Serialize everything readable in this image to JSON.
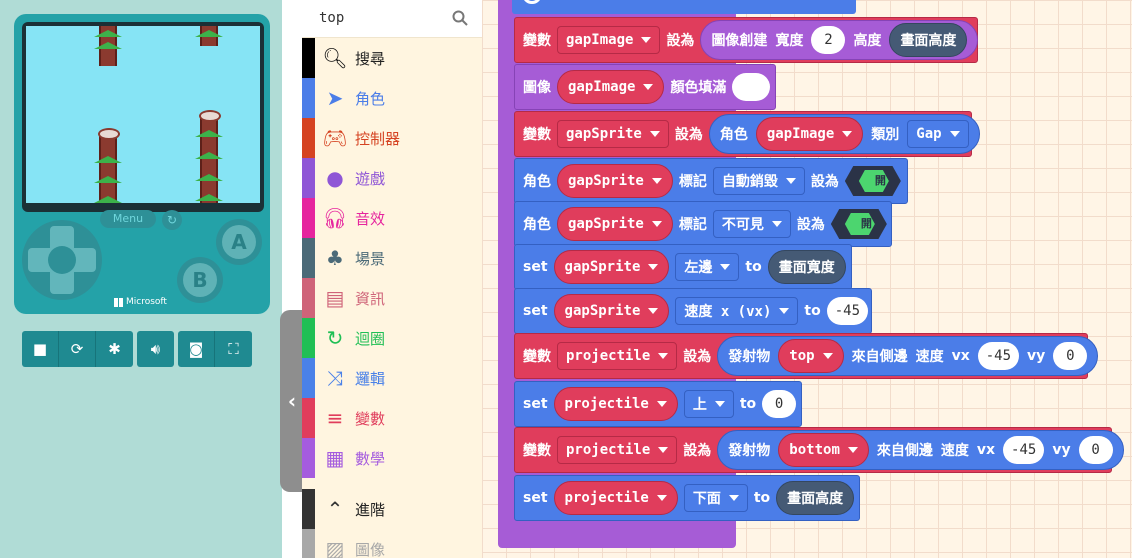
{
  "simulator": {
    "menu_label": "Menu",
    "brand": "Microsoft",
    "button_a": "A",
    "button_b": "B",
    "toolbar": [
      "stop",
      "restart",
      "debug",
      "mute",
      "screenshot",
      "fullscreen"
    ]
  },
  "toolbox": {
    "search_value": "top",
    "categories": [
      {
        "label": "搜尋",
        "color": "#000000",
        "icon": "search-icon"
      },
      {
        "label": "角色",
        "color": "#4b7de8",
        "icon": "paper-plane-icon"
      },
      {
        "label": "控制器",
        "color": "#d54322",
        "icon": "gamepad-icon"
      },
      {
        "label": "遊戲",
        "color": "#8f56d6",
        "icon": "circle-icon"
      },
      {
        "label": "音效",
        "color": "#e6259e",
        "icon": "headphones-icon"
      },
      {
        "label": "場景",
        "color": "#4b6a78",
        "icon": "tree-icon"
      },
      {
        "label": "資訊",
        "color": "#cf6379",
        "icon": "id-card-icon"
      },
      {
        "label": "迴圈",
        "color": "#20bf55",
        "icon": "loop-icon"
      },
      {
        "label": "邏輯",
        "color": "#4a81e8",
        "icon": "shuffle-icon"
      },
      {
        "label": "變數",
        "color": "#e03d5c",
        "icon": "lines-icon"
      },
      {
        "label": "數學",
        "color": "#a55cde",
        "icon": "calculator-icon"
      },
      {
        "label": "進階",
        "color": "#333333",
        "icon": "chevron-up-icon"
      },
      {
        "label": "圖像",
        "color": "#a8a8a8",
        "icon": "image-icon"
      }
    ]
  },
  "blocks": {
    "b1": {
      "kw": "變數",
      "var": "gapImage",
      "set": "設為",
      "fn": "圖像創建",
      "w": "寬度",
      "wv": "2",
      "h": "高度",
      "hv": "畫面高度"
    },
    "b2": {
      "kw": "圖像",
      "var": "gapImage",
      "fn": "顏色填滿"
    },
    "b3": {
      "kw": "變數",
      "var": "gapSprite",
      "set": "設為",
      "fn": "角色",
      "img": "gapImage",
      "kind": "類別",
      "kindv": "Gap"
    },
    "b4": {
      "kw": "角色",
      "var": "gapSprite",
      "flag": "標記",
      "flagv": "自動銷毀",
      "set": "設為",
      "tog": "開"
    },
    "b5": {
      "kw": "角色",
      "var": "gapSprite",
      "flag": "標記",
      "flagv": "不可見",
      "set": "設為",
      "tog": "開"
    },
    "b6": {
      "kw": "set",
      "var": "gapSprite",
      "prop": "左邊",
      "to": "to",
      "val": "畫面寬度"
    },
    "b7": {
      "kw": "set",
      "var": "gapSprite",
      "prop": "速度 x (vx)",
      "to": "to",
      "val": "-45"
    },
    "b8": {
      "kw": "變數",
      "var": "projectile",
      "set": "設為",
      "fn": "發射物",
      "img": "top",
      "side": "來自側邊",
      "speed": "速度",
      "vx": "vx",
      "vxv": "-45",
      "vy": "vy",
      "vyv": "0"
    },
    "b9": {
      "kw": "set",
      "var": "projectile",
      "prop": "上",
      "to": "to",
      "val": "0"
    },
    "b10": {
      "kw": "變數",
      "var": "projectile",
      "set": "設為",
      "fn": "發射物",
      "img": "bottom",
      "side": "來自側邊",
      "speed": "速度",
      "vx": "vx",
      "vxv": "-45",
      "vy": "vy",
      "vyv": "0"
    },
    "b11": {
      "kw": "set",
      "var": "projectile",
      "prop": "下面",
      "to": "to",
      "val": "畫面高度"
    }
  }
}
